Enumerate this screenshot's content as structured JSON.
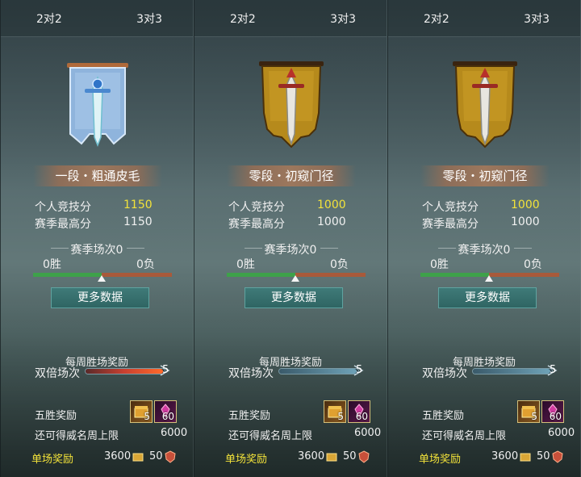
{
  "panels": [
    {
      "tabs": [
        "2对2",
        "3对3"
      ],
      "emblem": "silver-blue-sword-banner-icon",
      "rank": "一段・粗通皮毛",
      "personal_label": "个人竞技分",
      "personal_value": "1150",
      "season_high_label": "赛季最高分",
      "season_high_value": "1150",
      "season_games": "赛季场次0",
      "wins": "0胜",
      "losses": "0负",
      "more_button": "更多数据",
      "weekly_title": "每周胜场奖励",
      "double_label": "双倍场次",
      "double_count": "5",
      "double_fill_color": "#c94030",
      "five_win_label": "五胜奖励",
      "item1_count": "5",
      "item2_count": "60",
      "limit_label": "还可得威名周上限",
      "limit_value": "6000",
      "single_label": "单场奖励",
      "single_value1": "3600",
      "single_value2": "50"
    },
    {
      "tabs": [
        "2对2",
        "3对3"
      ],
      "emblem": "gold-sword-banner-icon",
      "rank": "零段・初窥门径",
      "personal_label": "个人竞技分",
      "personal_value": "1000",
      "season_high_label": "赛季最高分",
      "season_high_value": "1000",
      "season_games": "赛季场次0",
      "wins": "0胜",
      "losses": "0负",
      "more_button": "更多数据",
      "weekly_title": "每周胜场奖励",
      "double_label": "双倍场次",
      "double_count": "5",
      "double_fill_color": "#6fa3b8",
      "five_win_label": "五胜奖励",
      "item1_count": "5",
      "item2_count": "60",
      "limit_label": "还可得威名周上限",
      "limit_value": "6000",
      "single_label": "单场奖励",
      "single_value1": "3600",
      "single_value2": "50"
    },
    {
      "tabs": [
        "2对2",
        "3对3"
      ],
      "emblem": "gold-sword-banner-icon",
      "rank": "零段・初窥门径",
      "personal_label": "个人竞技分",
      "personal_value": "1000",
      "season_high_label": "赛季最高分",
      "season_high_value": "1000",
      "season_games": "赛季场次0",
      "wins": "0胜",
      "losses": "0负",
      "more_button": "更多数据",
      "weekly_title": "每周胜场奖励",
      "double_label": "双倍场次",
      "double_count": "5",
      "double_fill_color": "#6fa3b8",
      "five_win_label": "五胜奖励",
      "item1_count": "5",
      "item2_count": "60",
      "limit_label": "还可得威名周上限",
      "limit_value": "6000",
      "single_label": "单场奖励",
      "single_value1": "3600",
      "single_value2": "50"
    }
  ]
}
